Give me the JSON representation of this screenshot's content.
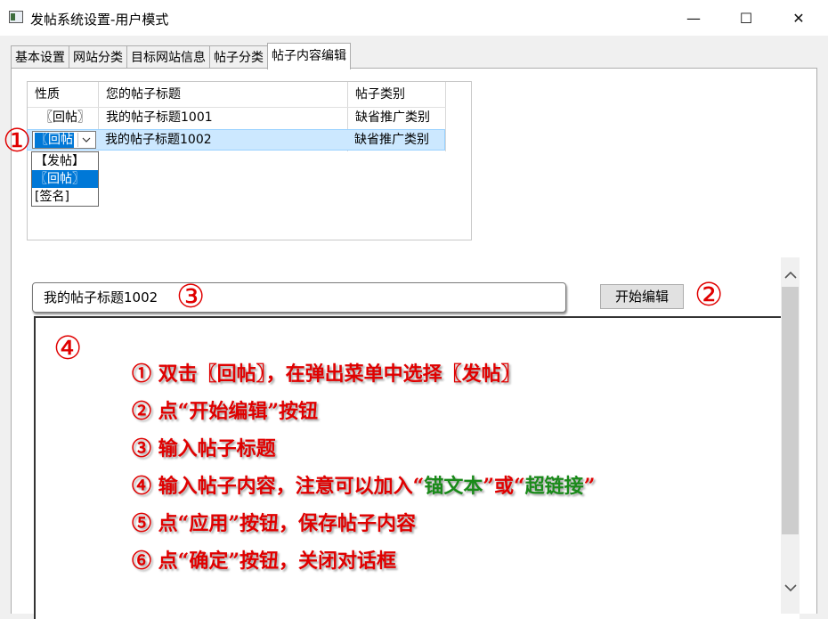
{
  "window": {
    "title": "发帖系统设置-用户模式",
    "minimize": "—",
    "maximize": "☐",
    "close": "✕"
  },
  "tabs": [
    {
      "label": "基本设置"
    },
    {
      "label": "网站分类"
    },
    {
      "label": "目标网站信息"
    },
    {
      "label": "帖子分类"
    },
    {
      "label": "帖子内容编辑"
    }
  ],
  "grid": {
    "columns": [
      "性质",
      "您的帖子标题",
      "帖子类别"
    ],
    "rows": [
      {
        "type": "〖回帖〗",
        "title": "我的帖子标题1001",
        "category": "缺省推广类别"
      },
      {
        "type": "〖回帖",
        "title": "我的帖子标题1002",
        "category": "缺省推广类别"
      }
    ],
    "dropdown_options": [
      "【发帖】",
      "〖回帖〗",
      "[签名]"
    ]
  },
  "editor": {
    "title_value": "我的帖子标题1002",
    "start_button": "开始编辑"
  },
  "annotations": {
    "n1": "①",
    "n2": "②",
    "n3": "③",
    "n4": "④"
  },
  "instructions": [
    {
      "num": "①",
      "text": " 双击〖回帖〗，在弹出菜单中选择〖发帖〗"
    },
    {
      "num": "②",
      "text": " 点“开始编辑”按钮"
    },
    {
      "num": "③",
      "text": " 输入帖子标题"
    },
    {
      "num": "④",
      "pre": " 输入帖子内容，注意可以加入“",
      "g1": "锚文本",
      "mid": "”或“",
      "g2": "超链接",
      "post": "”"
    },
    {
      "num": "⑤",
      "text": " 点“应用”按钮，保存帖子内容"
    },
    {
      "num": "⑥",
      "text": " 点“确定”按钮，关闭对话框"
    }
  ],
  "colors": {
    "annotation": "#e00000",
    "highlight": "#1a8a1a",
    "selection": "#0078d7"
  }
}
